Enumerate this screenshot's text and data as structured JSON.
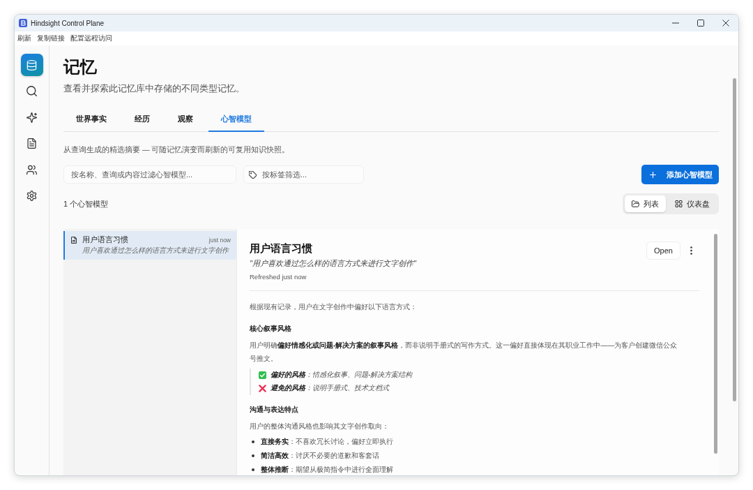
{
  "window": {
    "title": "Hindsight Control Plane"
  },
  "menu": [
    "刷新",
    "复制链接",
    "配置远程访问"
  ],
  "sidebar": {
    "items": [
      {
        "kind": "memory",
        "selected": true
      },
      {
        "kind": "search",
        "selected": false
      },
      {
        "kind": "insights",
        "selected": false
      },
      {
        "kind": "documents",
        "selected": false
      },
      {
        "kind": "people",
        "selected": false
      },
      {
        "kind": "settings",
        "selected": false
      }
    ]
  },
  "page": {
    "title": "记忆",
    "subtitle": "查看并探索此记忆库中存储的不同类型记忆。"
  },
  "tabs": [
    {
      "label": "世界事实",
      "selected": false
    },
    {
      "label": "经历",
      "selected": false
    },
    {
      "label": "观察",
      "selected": false
    },
    {
      "label": "心智模型",
      "selected": true
    }
  ],
  "description": "从查询生成的精选摘要 — 可随记忆演变而刷新的可复用知识快照。",
  "filters": {
    "search": {
      "placeholder": "按名称、查询或内容过滤心智模型..."
    },
    "tags": {
      "placeholder": "按标签筛选..."
    }
  },
  "add_button": "添加心智模型",
  "count": "1 个心智模型",
  "view_toggle": [
    {
      "label": "列表",
      "kind": "list",
      "selected": true
    },
    {
      "label": "仪表盘",
      "kind": "dashboard",
      "selected": false
    }
  ],
  "models": [
    {
      "name": "用户语言习惯",
      "time": "just now",
      "query": "用户喜欢通过怎么样的语言方式来进行文字创作",
      "selected": true
    }
  ],
  "detail": {
    "title": "用户语言习惯",
    "query": "\"用户喜欢通过怎么样的语言方式来进行文字创作\"",
    "refreshed": "Refreshed just now",
    "open_button": "Open",
    "blocks": [
      {
        "kind": "paragraph",
        "text": "根据现有记录，用户在文字创作中偏好以下语言方式："
      },
      {
        "kind": "heading",
        "text": "核心叙事风格"
      },
      {
        "kind": "paragraph",
        "text": "用户明确**偏好情感化或问题-解决方案的叙事风格**，而非说明手册式的写作方式。这一偏好直接体现在其职业工作中——为客户创建微信公众号推文。"
      },
      {
        "kind": "quote",
        "lines": [
          {
            "kind": "preferred",
            "text": "**偏好的风格**：情感化叙事、问题-解决方案结构"
          },
          {
            "kind": "avoided",
            "text": "**避免的风格**：说明手册式、技术文档式"
          }
        ]
      },
      {
        "kind": "heading",
        "text": "沟通与表达特点"
      },
      {
        "kind": "paragraph",
        "text": "用户的整体沟通风格也影响其文字创作取向："
      },
      {
        "kind": "list",
        "items": [
          "**直接务实**：不喜欢冗长讨论，偏好立即执行",
          "**简洁高效**：讨厌不必要的道歉和客套话",
          "**整体推断**：期望从极简指令中进行全面理解"
        ]
      }
    ]
  }
}
